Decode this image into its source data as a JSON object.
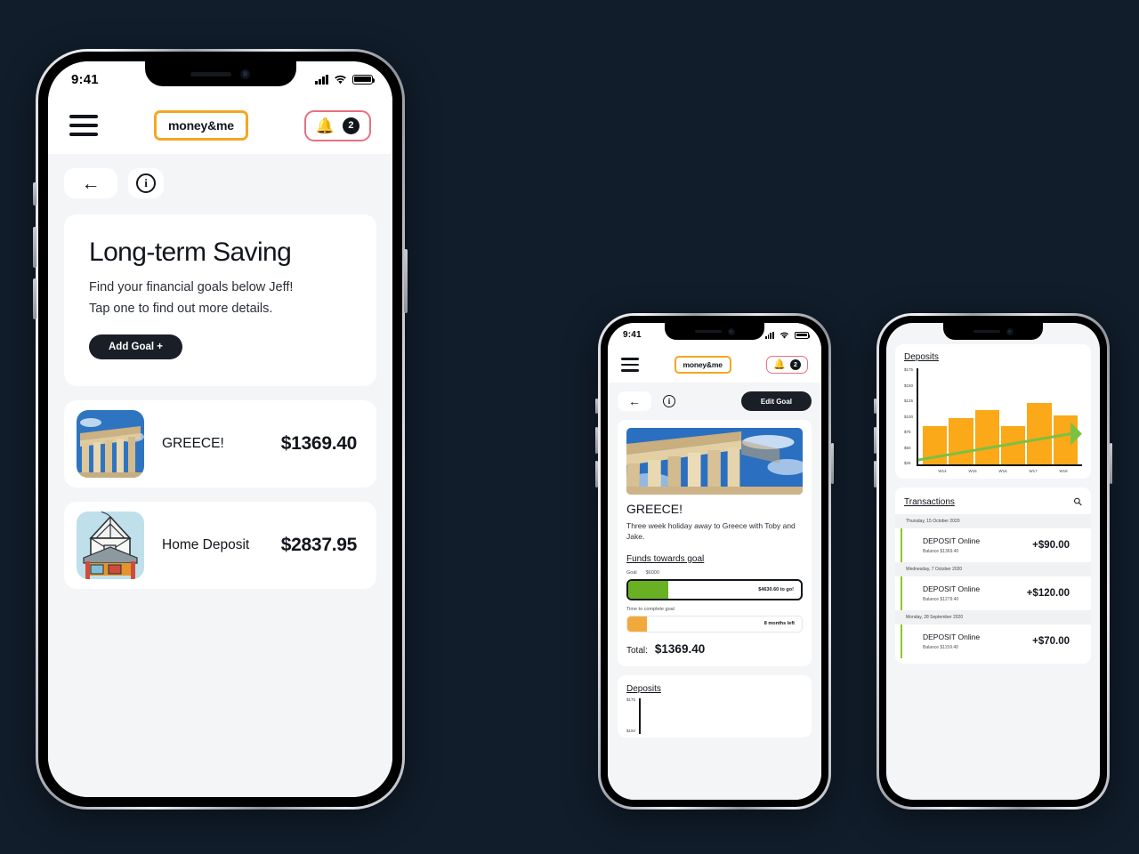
{
  "theme": {
    "background": "#111d2b",
    "accent_orange": "#f5a623",
    "accent_green": "#6ab023",
    "dark": "#1a1f27",
    "bell_border": "#e8717f",
    "bar_orange": "#fba819",
    "trend_green": "#7ac142"
  },
  "phone1": {
    "status": {
      "time": "9:41",
      "signal": "cellular-bars-icon",
      "wifi": "wifi-icon",
      "battery": "battery-icon"
    },
    "appbar": {
      "menu": "hamburger-menu-icon",
      "logo": "money&me",
      "bell": "bell-icon",
      "badge": "2"
    },
    "toolbar": {
      "back": "arrow-left-icon",
      "info": "info-circle-icon"
    },
    "hero": {
      "title": "Long-term Saving",
      "line1": "Find your financial goals below Jeff!",
      "line2": "Tap one to find out more details.",
      "add_goal_label": "Add Goal +"
    },
    "goals": [
      {
        "name": "GREECE!",
        "amount": "$1369.40",
        "image": "parthenon-photo"
      },
      {
        "name": "Home Deposit",
        "amount": "$2837.95",
        "image": "house-photo"
      }
    ]
  },
  "phone2": {
    "status": {
      "time": "9:41"
    },
    "appbar": {
      "logo": "money&me",
      "badge": "2"
    },
    "toolbar": {
      "back": "arrow-left-icon",
      "info": "info-circle-icon",
      "edit_goal_label": "Edit Goal"
    },
    "detail": {
      "title": "GREECE!",
      "description": "Three week holiday away to Greece with Toby and Jake.",
      "funds_heading": "Funds towards goal",
      "goal_label": "Goal",
      "goal_value": "$6000",
      "remaining_text": "$4630.60 to go!",
      "progress_percent": 23,
      "time_label": "Time to complete goal",
      "time_text": "8 months left",
      "time_percent": 11,
      "total_label": "Total:",
      "total_value": "$1369.40",
      "deposits_heading": "Deposits",
      "deposits_axis": [
        "$175",
        "$150"
      ]
    }
  },
  "phone3": {
    "deposits_heading": "Deposits",
    "transactions_heading": "Transactions",
    "search_icon": "search-icon",
    "transactions": [
      {
        "date": "Thursday, 15 October 2020",
        "name": "DEPOSIT Online",
        "balance": "Balance $1369.40",
        "amount": "+$90.00"
      },
      {
        "date": "Wednesday, 7 October 2020",
        "name": "DEPOSIT Online",
        "balance": "Balance $1279.40",
        "amount": "+$120.00"
      },
      {
        "date": "Monday, 28 September 2020",
        "name": "DEPOSIT Online",
        "balance": "Balance $1159.40",
        "amount": "+$70.00"
      }
    ]
  },
  "chart_data": {
    "type": "bar",
    "title": "Deposits",
    "categories": [
      "W14",
      "W15",
      "W16",
      "W17",
      "W18"
    ],
    "values": [
      75,
      90,
      105,
      75,
      120,
      95
    ],
    "series": [
      {
        "name": "Deposits",
        "values": [
          75,
          90,
          105,
          75,
          120,
          95
        ]
      }
    ],
    "ytick_labels": [
      "$175",
      "$150",
      "$125",
      "$100",
      "$75",
      "$50",
      "$25"
    ],
    "ylim": [
      0,
      187
    ],
    "xlabel": "",
    "ylabel": "",
    "grid": false,
    "legend": "none",
    "annotations": [
      {
        "type": "trendline",
        "color": "#7ac142",
        "from": [
          0,
          82
        ],
        "to": [
          5,
          112
        ],
        "arrow": true
      }
    ]
  }
}
